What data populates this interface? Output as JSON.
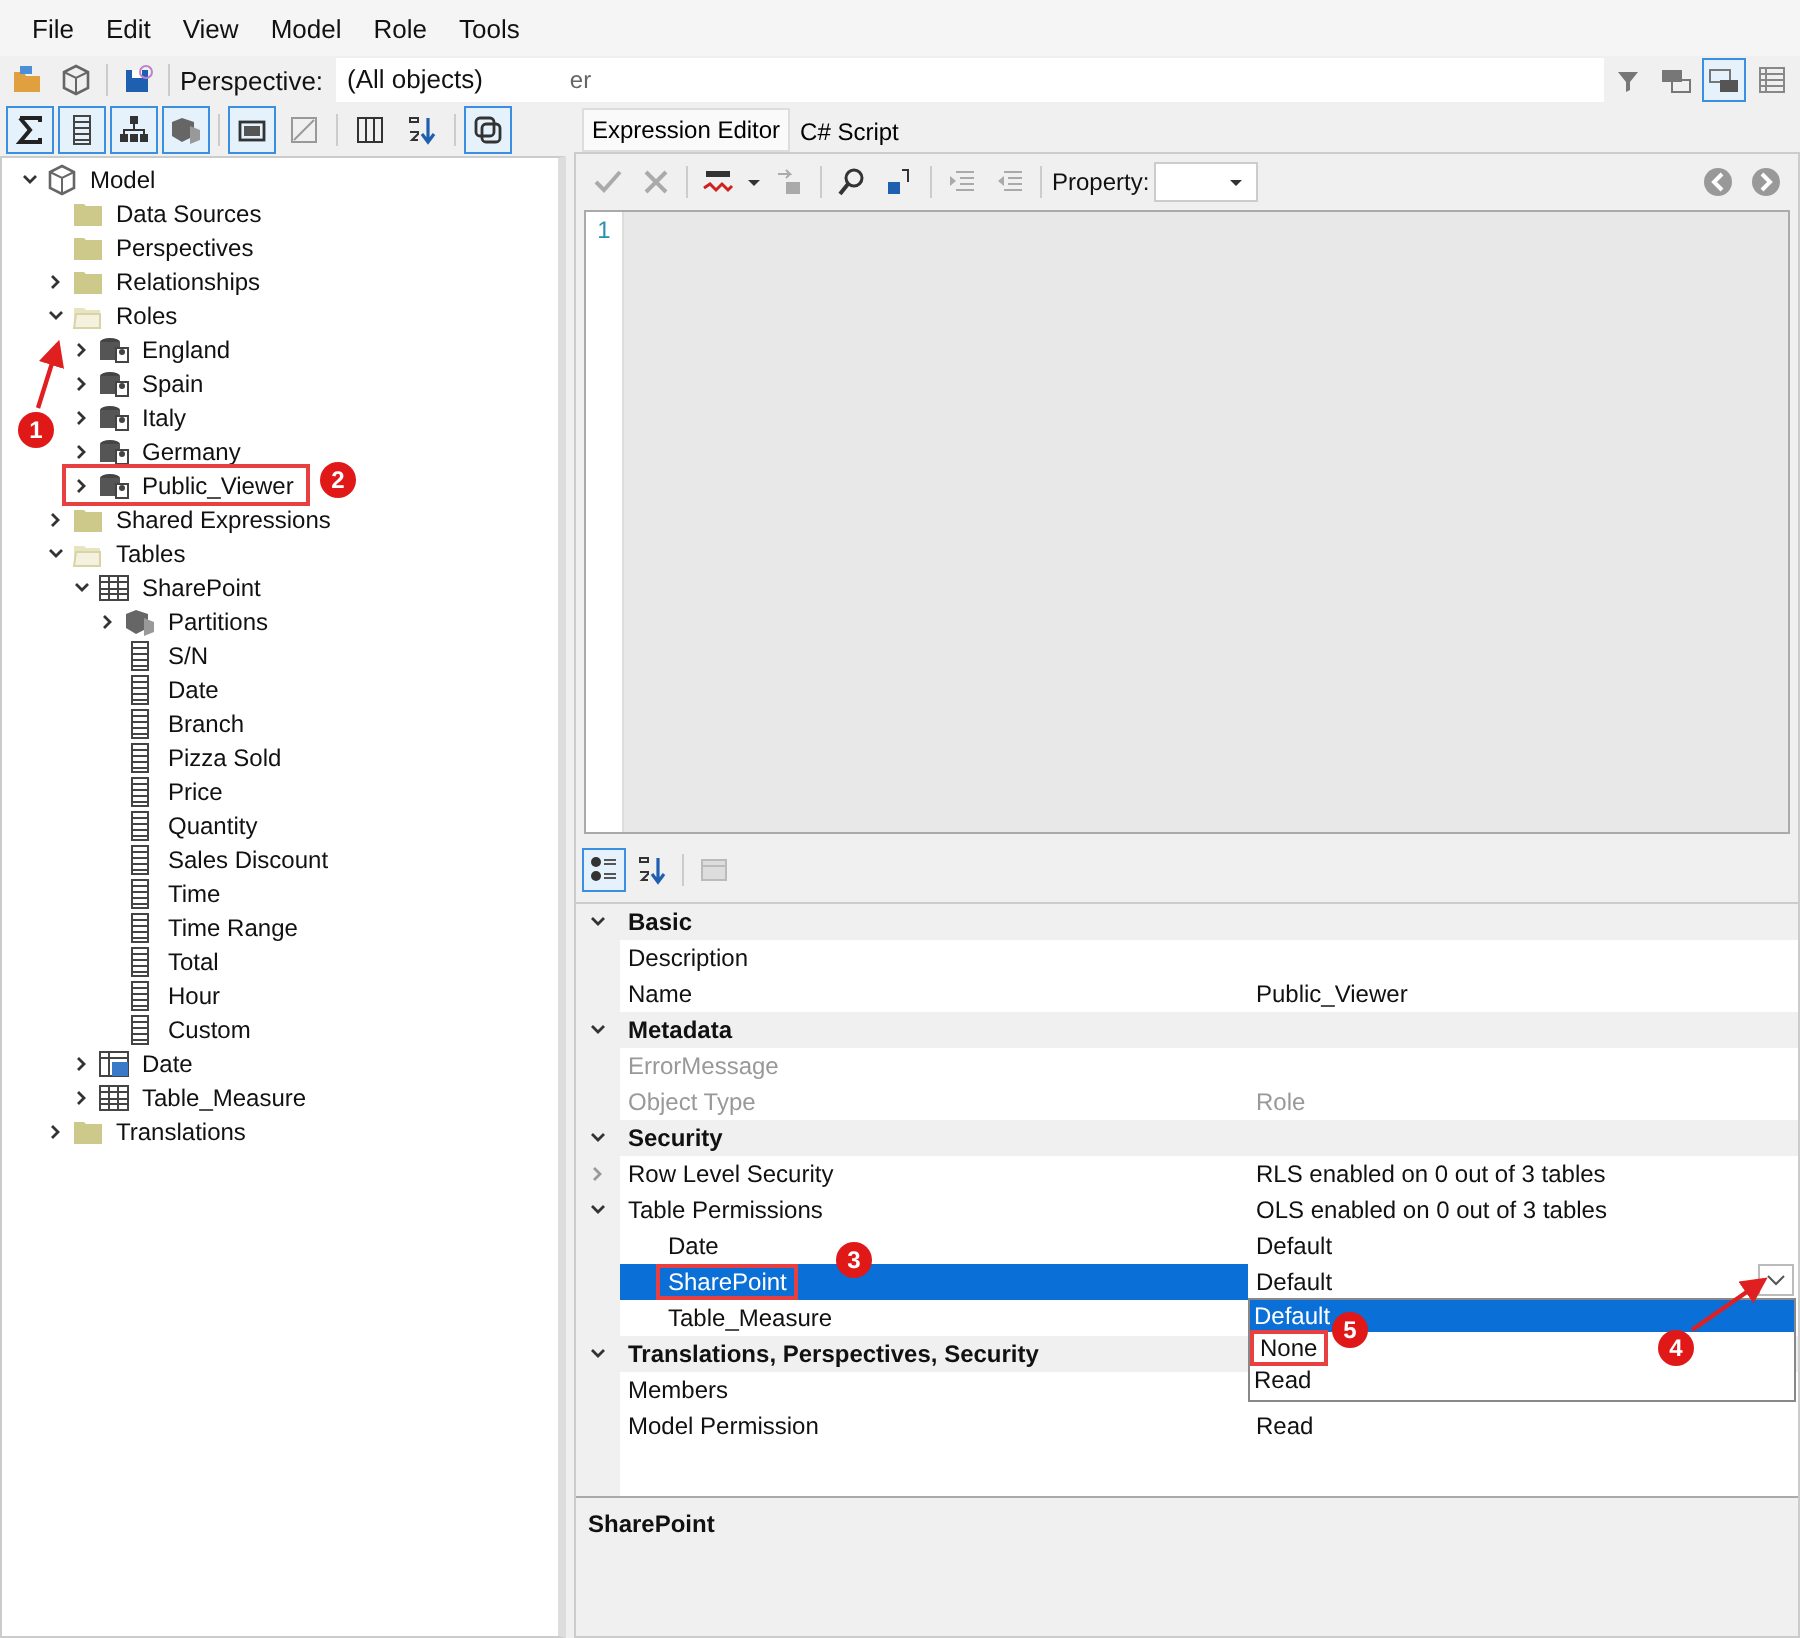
{
  "menu": [
    {
      "label": "File"
    },
    {
      "label": "Edit"
    },
    {
      "label": "View"
    },
    {
      "label": "Model"
    },
    {
      "label": "Role"
    },
    {
      "label": "Tools"
    }
  ],
  "toolbar": {
    "perspective_label": "Perspective:",
    "perspective_value": "(All objects)",
    "fragment": "er",
    "right_toggles": [
      {
        "selected": false
      },
      {
        "selected": false
      },
      {
        "selected": true
      },
      {
        "selected": false
      }
    ]
  },
  "tree_toolbar": {
    "toggles": [
      {
        "selected": true
      },
      {
        "selected": true
      },
      {
        "selected": true
      },
      {
        "selected": true
      },
      {
        "selected": true
      },
      {
        "selected": false
      },
      {
        "selected": false
      },
      {
        "selected": false
      },
      {
        "selected": true
      }
    ]
  },
  "tree": [
    {
      "label": "Model",
      "kind": "model",
      "expanded": true,
      "children": [
        {
          "label": "Data Sources",
          "kind": "folder"
        },
        {
          "label": "Perspectives",
          "kind": "folder"
        },
        {
          "label": "Relationships",
          "kind": "folder",
          "expanded": false
        },
        {
          "label": "Roles",
          "kind": "folder",
          "expanded": true,
          "children": [
            {
              "label": "England",
              "kind": "role",
              "expanded": false
            },
            {
              "label": "Spain",
              "kind": "role",
              "expanded": false
            },
            {
              "label": "Italy",
              "kind": "role",
              "expanded": false
            },
            {
              "label": "Germany",
              "kind": "role",
              "expanded": false
            },
            {
              "label": "Public_Viewer",
              "kind": "role",
              "expanded": false,
              "highlighted": true
            }
          ]
        },
        {
          "label": "Shared Expressions",
          "kind": "folder",
          "expanded": false
        },
        {
          "label": "Tables",
          "kind": "folder",
          "expanded": true,
          "children": [
            {
              "label": "SharePoint",
              "kind": "table",
              "expanded": true,
              "children": [
                {
                  "label": "Partitions",
                  "kind": "partitions",
                  "expanded": false
                },
                {
                  "label": "S/N",
                  "kind": "column"
                },
                {
                  "label": "Date",
                  "kind": "column"
                },
                {
                  "label": "Branch",
                  "kind": "column"
                },
                {
                  "label": "Pizza Sold",
                  "kind": "column"
                },
                {
                  "label": "Price",
                  "kind": "column"
                },
                {
                  "label": "Quantity",
                  "kind": "column"
                },
                {
                  "label": "Sales Discount",
                  "kind": "column"
                },
                {
                  "label": "Time",
                  "kind": "column"
                },
                {
                  "label": "Time Range",
                  "kind": "column"
                },
                {
                  "label": "Total",
                  "kind": "column"
                },
                {
                  "label": "Hour",
                  "kind": "column"
                },
                {
                  "label": "Custom",
                  "kind": "column"
                }
              ]
            },
            {
              "label": "Date",
              "kind": "date-table",
              "expanded": false
            },
            {
              "label": "Table_Measure",
              "kind": "table",
              "expanded": false
            }
          ]
        },
        {
          "label": "Translations",
          "kind": "folder",
          "expanded": false
        }
      ]
    }
  ],
  "tabs": [
    {
      "label": "Expression Editor",
      "selected": true
    },
    {
      "label": "C# Script",
      "selected": false
    }
  ],
  "editor": {
    "property_label": "Property:",
    "line_numbers": [
      "1"
    ]
  },
  "properties_toolbar": {
    "toggles": [
      {
        "selected": true
      },
      {
        "selected": false
      }
    ]
  },
  "properties": [
    {
      "name": "Basic",
      "expanded": true,
      "rows": [
        {
          "name": "Description",
          "selected": false
        },
        {
          "name": "Name",
          "value": "Public_Viewer",
          "selected": false
        }
      ]
    },
    {
      "name": "Metadata",
      "expanded": true,
      "rows": [
        {
          "name": "ErrorMessage",
          "disabled": true,
          "selected": false
        },
        {
          "name": "Object Type",
          "value": "Role",
          "disabled": true,
          "selected": false
        }
      ]
    },
    {
      "name": "Security",
      "expanded": true,
      "rows": [
        {
          "name": "Row Level Security",
          "value": "RLS enabled on 0 out of 3 tables",
          "expanded": false,
          "selected": false
        },
        {
          "name": "Table Permissions",
          "value": "OLS enabled on 0 out of 3 tables",
          "expanded": true,
          "selected": false,
          "children": [
            {
              "name": "Date",
              "value": "Default",
              "selected": false
            },
            {
              "name": "SharePoint",
              "value": "Default",
              "selected": true,
              "highlighted": true,
              "dropdown": [
                {
                  "label": "Default",
                  "selected": true
                },
                {
                  "label": "None",
                  "selected": false,
                  "highlighted": true
                },
                {
                  "label": "Read",
                  "selected": false
                }
              ]
            },
            {
              "name": "Table_Measure",
              "selected": false
            }
          ]
        }
      ]
    },
    {
      "name": "Translations, Perspectives, Security",
      "expanded": true,
      "rows": [
        {
          "name": "Members",
          "selected": false
        },
        {
          "name": "Model Permission",
          "value": "Read",
          "selected": false
        }
      ]
    }
  ],
  "description": {
    "title": "SharePoint"
  },
  "annotations": [
    {
      "number": "1"
    },
    {
      "number": "2"
    },
    {
      "number": "3"
    },
    {
      "number": "4"
    },
    {
      "number": "5"
    }
  ]
}
